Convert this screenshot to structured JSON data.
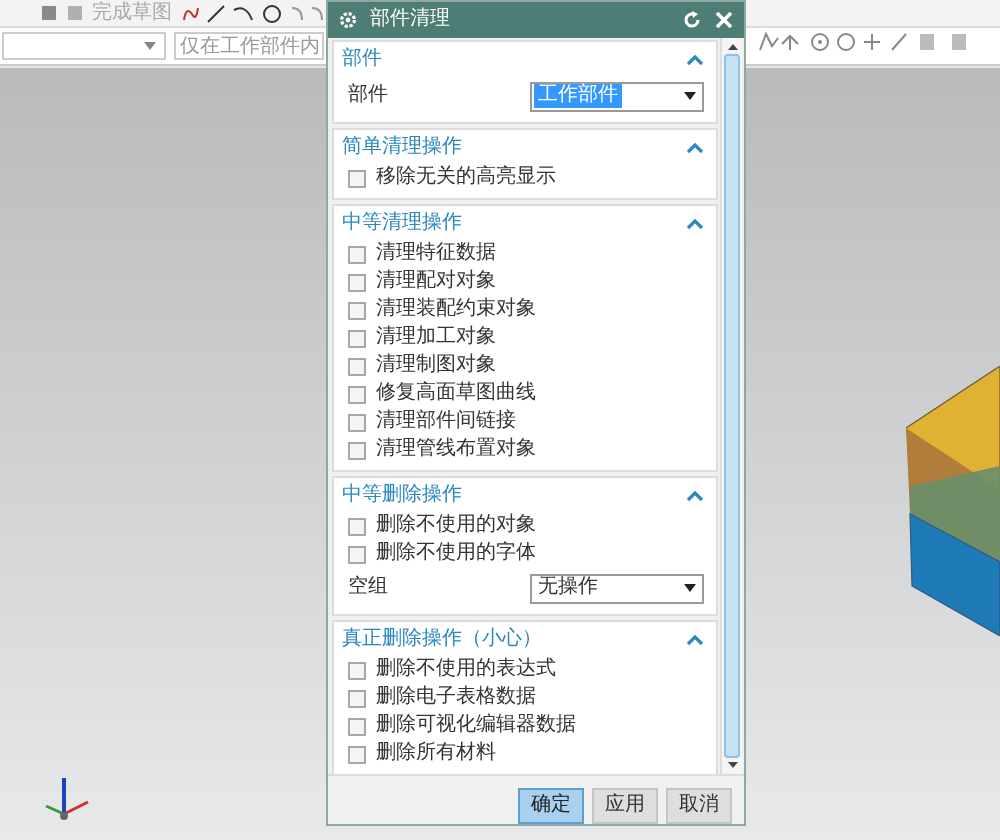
{
  "toolbar": {
    "finish_sketch": "完成草图",
    "filter_placeholder": "仅在工作部件内"
  },
  "dialog": {
    "title": "部件清理",
    "sections": [
      {
        "title": "部件",
        "expanded": true,
        "rows": [
          {
            "kind": "select",
            "label": "部件",
            "value": "工作部件",
            "highlighted": true
          }
        ]
      },
      {
        "title": "简单清理操作",
        "expanded": true,
        "rows": [
          {
            "kind": "checkbox",
            "label": "移除无关的高亮显示",
            "checked": false
          }
        ]
      },
      {
        "title": "中等清理操作",
        "expanded": true,
        "rows": [
          {
            "kind": "checkbox",
            "label": "清理特征数据",
            "checked": false
          },
          {
            "kind": "checkbox",
            "label": "清理配对对象",
            "checked": false
          },
          {
            "kind": "checkbox",
            "label": "清理装配约束对象",
            "checked": false
          },
          {
            "kind": "checkbox",
            "label": "清理加工对象",
            "checked": false
          },
          {
            "kind": "checkbox",
            "label": "清理制图对象",
            "checked": false
          },
          {
            "kind": "checkbox",
            "label": "修复高面草图曲线",
            "checked": false
          },
          {
            "kind": "checkbox",
            "label": "清理部件间链接",
            "checked": false
          },
          {
            "kind": "checkbox",
            "label": "清理管线布置对象",
            "checked": false
          }
        ]
      },
      {
        "title": "中等删除操作",
        "expanded": true,
        "rows": [
          {
            "kind": "checkbox",
            "label": "删除不使用的对象",
            "checked": false
          },
          {
            "kind": "checkbox",
            "label": "删除不使用的字体",
            "checked": false
          },
          {
            "kind": "select",
            "label": "空组",
            "value": "无操作",
            "highlighted": false
          }
        ]
      },
      {
        "title": "真正删除操作（小心）",
        "expanded": true,
        "rows": [
          {
            "kind": "checkbox",
            "label": "删除不使用的表达式",
            "checked": false
          },
          {
            "kind": "checkbox",
            "label": "删除电子表格数据",
            "checked": false
          },
          {
            "kind": "checkbox",
            "label": "删除可视化编辑器数据",
            "checked": false
          },
          {
            "kind": "checkbox",
            "label": "删除所有材料",
            "checked": false
          }
        ]
      }
    ],
    "buttons": [
      {
        "label": "确定",
        "selected": true
      },
      {
        "label": "应用",
        "selected": false
      },
      {
        "label": "取消",
        "selected": false
      }
    ]
  }
}
